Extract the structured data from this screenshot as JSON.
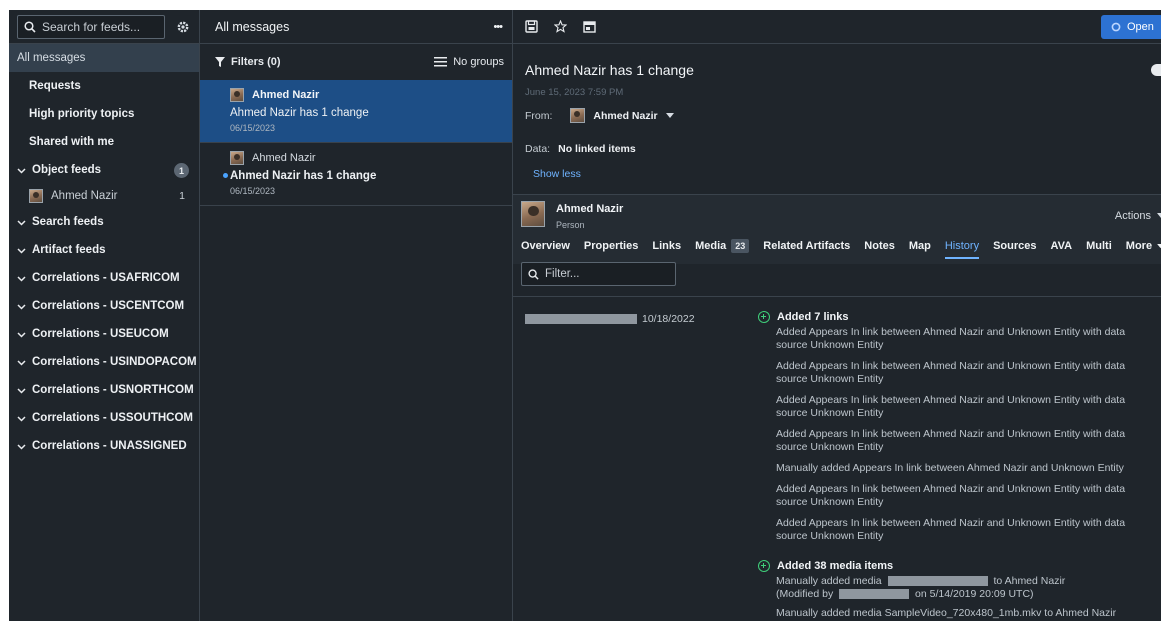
{
  "left": {
    "search_placeholder": "Search for feeds...",
    "nav": [
      {
        "label": "All messages"
      },
      {
        "label": "Requests"
      },
      {
        "label": "High priority topics"
      },
      {
        "label": "Shared with me"
      }
    ],
    "object_feeds": {
      "label": "Object feeds",
      "badge": "1",
      "items": [
        {
          "name": "Ahmed Nazir",
          "count": "1"
        }
      ]
    },
    "groups": [
      "Search feeds",
      "Artifact feeds",
      "Correlations - USAFRICOM",
      "Correlations - USCENTCOM",
      "Correlations - USEUCOM",
      "Correlations - USINDOPACOM",
      "Correlations - USNORTHCOM",
      "Correlations - USSOUTHCOM",
      "Correlations - UNASSIGNED"
    ]
  },
  "middle": {
    "title": "All messages",
    "more": "•••",
    "filters": "Filters (0)",
    "grouping": "No groups",
    "messages": [
      {
        "sender": "Ahmed Nazir",
        "subject": "Ahmed Nazir has 1 change",
        "date": "06/15/2023"
      },
      {
        "sender": "Ahmed Nazir",
        "subject": "Ahmed Nazir has 1 change",
        "date": "06/15/2023"
      }
    ]
  },
  "right": {
    "open_label": "Open",
    "title": "Ahmed Nazir has 1 change",
    "date": "June 15, 2023 7:59 PM",
    "from_label": "From:",
    "from_name": "Ahmed Nazir",
    "data_label": "Data:",
    "data_value": "No linked items",
    "show_less": "Show less",
    "object": {
      "name": "Ahmed Nazir",
      "type": "Person",
      "actions": "Actions"
    },
    "tabs": [
      {
        "label": "Overview"
      },
      {
        "label": "Properties"
      },
      {
        "label": "Links"
      },
      {
        "label": "Media",
        "count": "23"
      },
      {
        "label": "Related Artifacts"
      },
      {
        "label": "Notes"
      },
      {
        "label": "Map"
      },
      {
        "label": "History"
      },
      {
        "label": "Sources"
      },
      {
        "label": "AVA"
      },
      {
        "label": "Multi"
      },
      {
        "label": "More"
      }
    ],
    "filter_placeholder": "Filter...",
    "history": {
      "date": "10/18/2022",
      "links_head": "Added 7 links",
      "link_entries": [
        "Added Appears In link between Ahmed Nazir and Unknown Entity with data source Unknown Entity",
        "Added Appears In link between Ahmed Nazir and Unknown Entity with data source Unknown Entity",
        "Added Appears In link between Ahmed Nazir and Unknown Entity with data source Unknown Entity",
        "Added Appears In link between Ahmed Nazir and Unknown Entity with data source Unknown Entity",
        "Manually added Appears In link between Ahmed Nazir and Unknown Entity",
        "Added Appears In link between Ahmed Nazir and Unknown Entity with data source Unknown Entity",
        "Added Appears In link between Ahmed Nazir and Unknown Entity with data source Unknown Entity"
      ],
      "media_head": "Added 38 media items",
      "media_entry_prefix": "Manually added media",
      "media_entry_suffix": "to Ahmed Nazir",
      "modified_prefix": "(Modified by",
      "modified_suffix": "on 5/14/2019 20:09 UTC)",
      "media_entry_2": "Manually added media  SampleVideo_720x480_1mb.mkv to Ahmed Nazir"
    }
  }
}
